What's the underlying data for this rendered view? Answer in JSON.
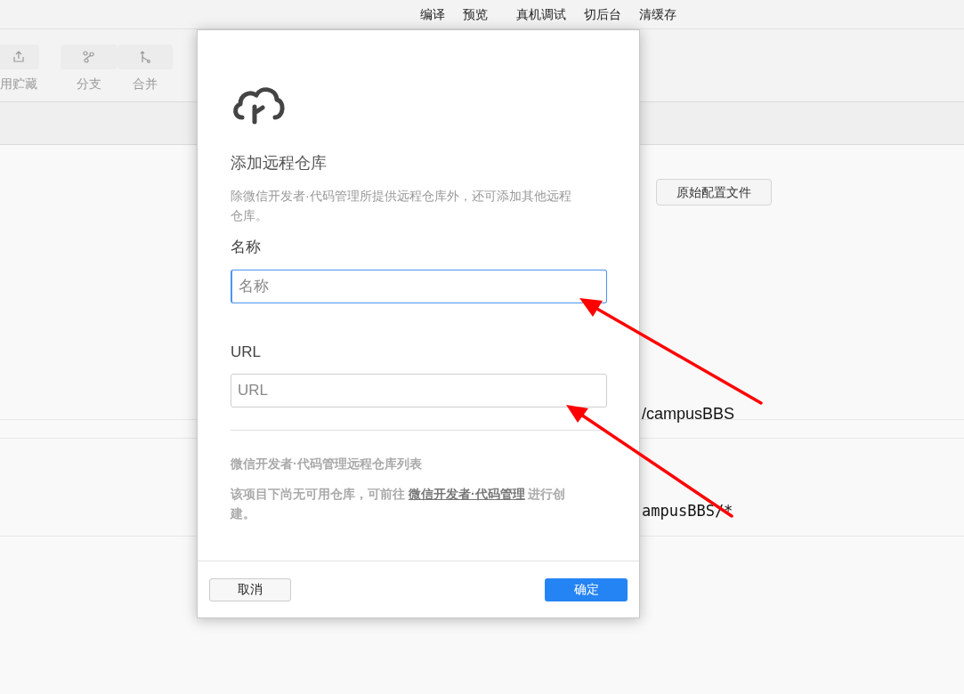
{
  "top_bar": {
    "items": [
      "编译",
      "预览",
      "真机调试",
      "切后台",
      "清缓存"
    ]
  },
  "toolbar": {
    "buttons": [
      {
        "label": "用贮藏",
        "kind": "upload"
      },
      {
        "label": "分支",
        "kind": "branch"
      },
      {
        "label": "合并",
        "kind": "merge"
      }
    ]
  },
  "config_buttons": [
    "原始配置文件"
  ],
  "remote_rows": [
    {
      "value": "/campusBBS",
      "kind": "url"
    },
    {
      "value": "ampusBBS/*",
      "kind": "fetch"
    }
  ],
  "dialog": {
    "title": "添加远程仓库",
    "description": "除微信开发者·代码管理所提供远程仓库外，还可添加其他远程仓库。",
    "fields": [
      {
        "label": "名称",
        "placeholder": "名称",
        "focused": true
      },
      {
        "label": "URL",
        "placeholder": "URL",
        "focused": false
      }
    ],
    "list_title": "微信开发者·代码管理远程仓库列表",
    "empty_message": {
      "before": "该项目下尚无可用仓库，可前往 ",
      "link": "微信开发者·代码管理",
      "after": " 进行创建。"
    },
    "buttons": {
      "cancel": "取消",
      "confirm": "确定"
    }
  }
}
